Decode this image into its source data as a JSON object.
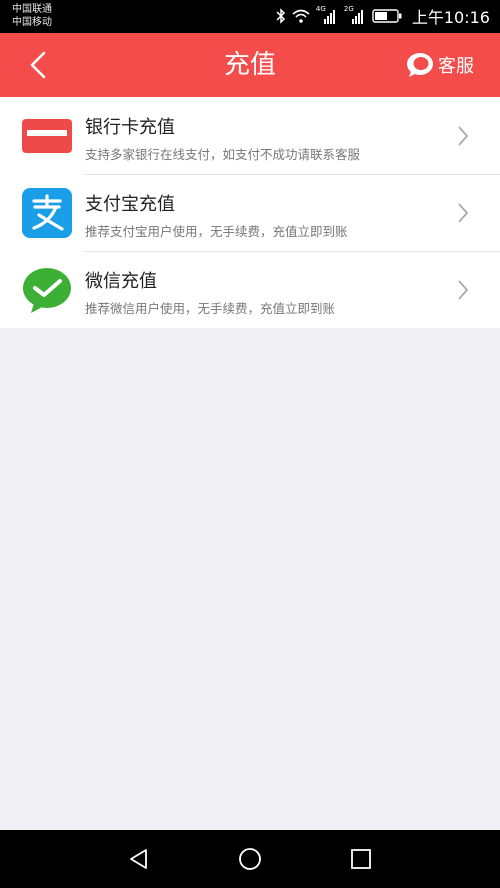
{
  "status_bar": {
    "carrier1": "中国联通",
    "carrier2": "中国移动",
    "net1": "4G",
    "net2": "2G",
    "time": "上午10:16"
  },
  "header": {
    "title": "充值",
    "service_label": "客服"
  },
  "methods": [
    {
      "title": "银行卡充值",
      "desc": "支持多家银行在线支付，如支付不成功请联系客服",
      "icon": "bank-card-icon",
      "color": "#ef4a4a"
    },
    {
      "title": "支付宝充值",
      "desc": "推荐支付宝用户使用，无手续费，充值立即到账",
      "icon": "alipay-icon",
      "color": "#1a9ee8"
    },
    {
      "title": "微信充值",
      "desc": "推荐微信用户使用，无手续费，充值立即到账",
      "icon": "wechat-icon",
      "color": "#3cb034"
    }
  ],
  "colors": {
    "header": "#f44b4b",
    "background": "#efeff4"
  }
}
